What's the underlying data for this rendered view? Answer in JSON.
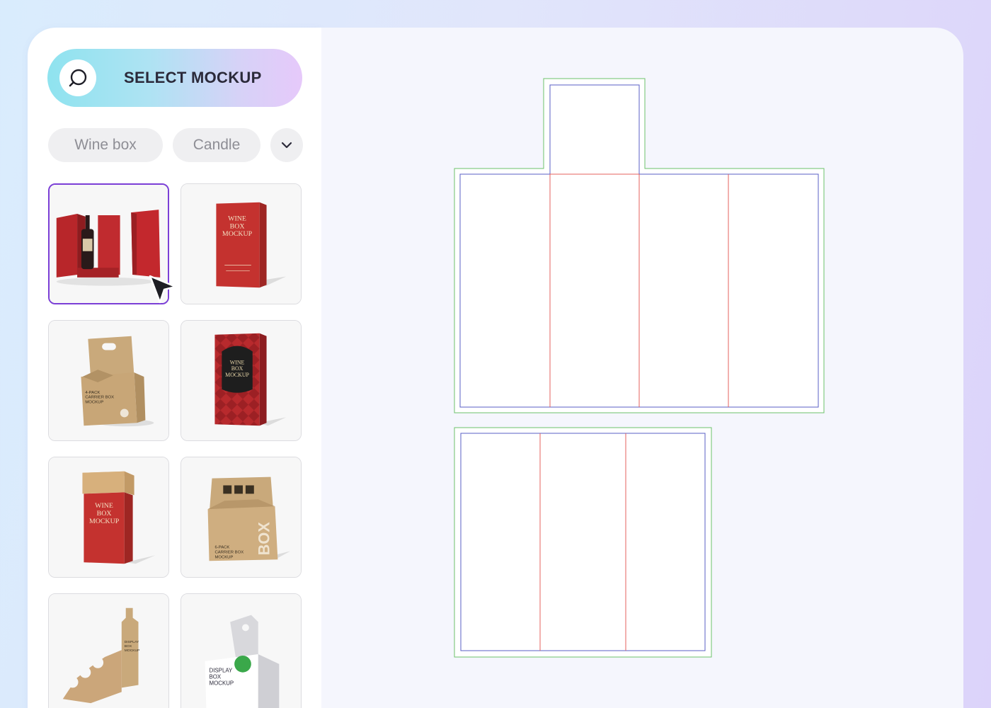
{
  "sidebar": {
    "select_button": {
      "label": "SELECT MOCKUP",
      "icon": "search-icon"
    },
    "filters": [
      {
        "label": "Wine box"
      },
      {
        "label": "Candle"
      }
    ],
    "more_filters_icon": "chevron-down-icon",
    "mockups": [
      {
        "name": "wine-box-open-display",
        "selected": true,
        "label": ""
      },
      {
        "name": "wine-box-red",
        "selected": false,
        "label": "WINE BOX MOCKUP"
      },
      {
        "name": "4-pack-carrier-box",
        "selected": false,
        "label": "4-PACK CARRIER BOX MOCKUP"
      },
      {
        "name": "wine-box-argyle",
        "selected": false,
        "label": "WINE BOX MOCKUP"
      },
      {
        "name": "wine-box-tube-lid",
        "selected": false,
        "label": "WINE BOX MOCKUP"
      },
      {
        "name": "6-pack-carrier-box",
        "selected": false,
        "label": "6-PACK CARRIER BOX MOCKUP"
      },
      {
        "name": "display-box-kraft",
        "selected": false,
        "label": "DISPLAY BOX MOCKUP"
      },
      {
        "name": "display-box-white",
        "selected": false,
        "label": "DISPLAY BOX MOCKUP"
      }
    ]
  },
  "colors": {
    "accent": "#7b3fd6",
    "dieline_bleed": "#6cc26a",
    "dieline_trim": "#5a5fc4",
    "dieline_fold": "#e4605c"
  }
}
